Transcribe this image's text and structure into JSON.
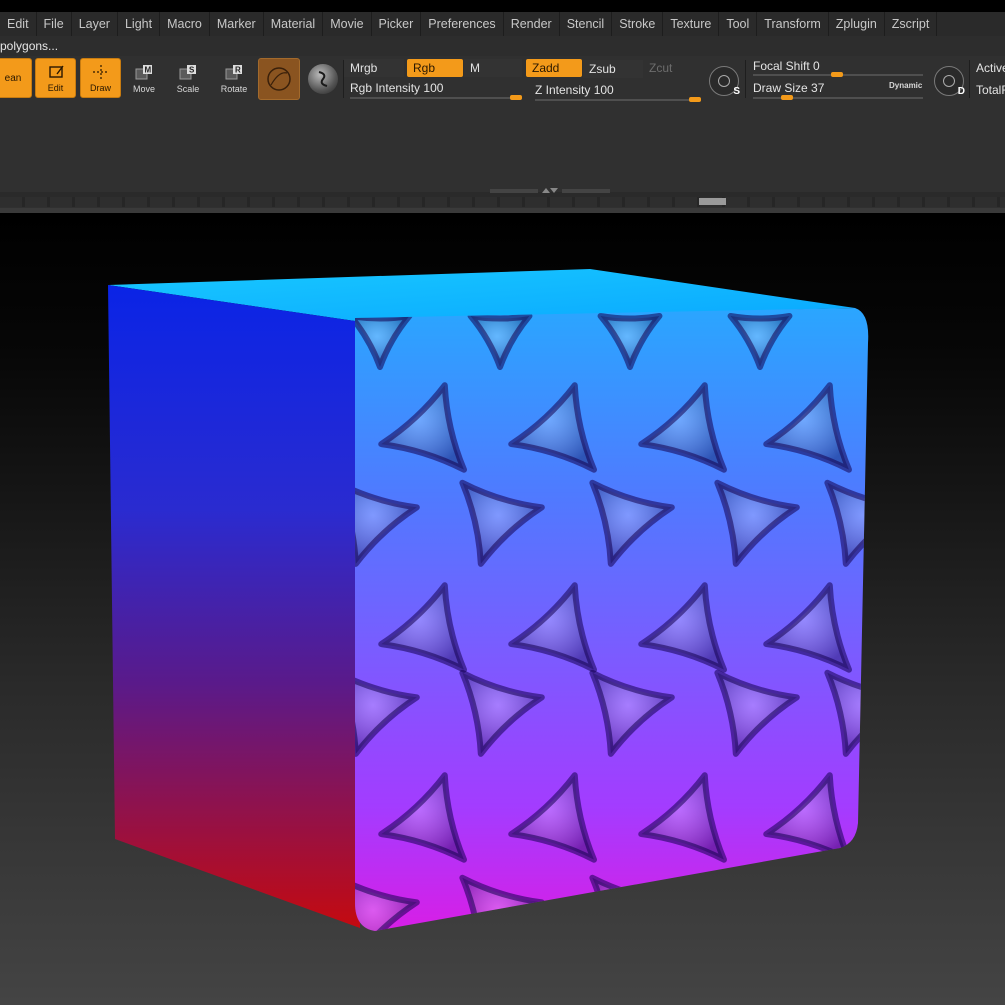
{
  "menu": [
    "Edit",
    "File",
    "Layer",
    "Light",
    "Macro",
    "Marker",
    "Material",
    "Movie",
    "Picker",
    "Preferences",
    "Render",
    "Stencil",
    "Stroke",
    "Texture",
    "Tool",
    "Transform",
    "Zplugin",
    "Zscript"
  ],
  "status_text": "polygons...",
  "toolbar": {
    "lightbox_label": "ean",
    "edit_label": "Edit",
    "draw_label": "Draw",
    "move_label": "Move",
    "scale_label": "Scale",
    "rotate_label": "Rotate"
  },
  "color_modes": {
    "mrgb": "Mrgb",
    "rgb": "Rgb",
    "m": "M"
  },
  "depth_modes": {
    "zadd": "Zadd",
    "zsub": "Zsub",
    "zcut": "Zcut"
  },
  "sliders": {
    "rgb_intensity": {
      "label": "Rgb Intensity",
      "value": "100"
    },
    "z_intensity": {
      "label": "Z Intensity",
      "value": "100"
    },
    "focal_shift": {
      "label": "Focal Shift",
      "value": "0"
    },
    "draw_size": {
      "label": "Draw Size",
      "value": "37"
    }
  },
  "dynamic_label": "Dynamic",
  "round_buttons": {
    "s": "S",
    "d": "D"
  },
  "right_labels": {
    "active": "Active",
    "total": "TotalF"
  },
  "colors": {
    "accent": "#f39a1a",
    "shelf": "#303030",
    "material": "#8a5420"
  }
}
